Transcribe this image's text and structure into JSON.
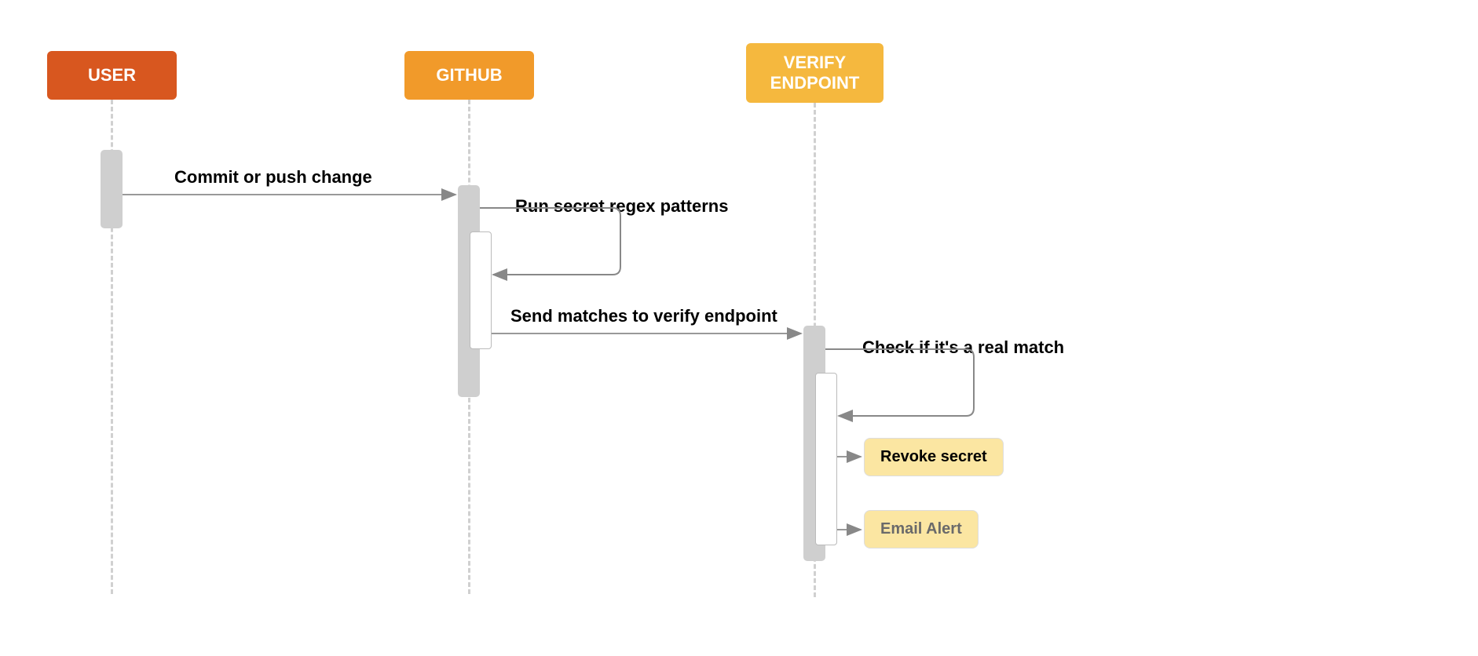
{
  "participants": {
    "user": "USER",
    "github": "GITHUB",
    "verify": "VERIFY ENDPOINT"
  },
  "messages": {
    "commit": "Commit or push change",
    "regex": "Run secret regex patterns",
    "send_verify": "Send matches to verify endpoint",
    "check_match": "Check if it's a real match"
  },
  "actions": {
    "revoke": "Revoke secret",
    "email": "Email Alert"
  },
  "colors": {
    "user": "#d8571f",
    "github": "#f19a2a",
    "verify": "#f5b83e",
    "action_bg": "#fbe6a2",
    "lifeline": "#d0d0d0",
    "activation": "#cfcfcf"
  }
}
